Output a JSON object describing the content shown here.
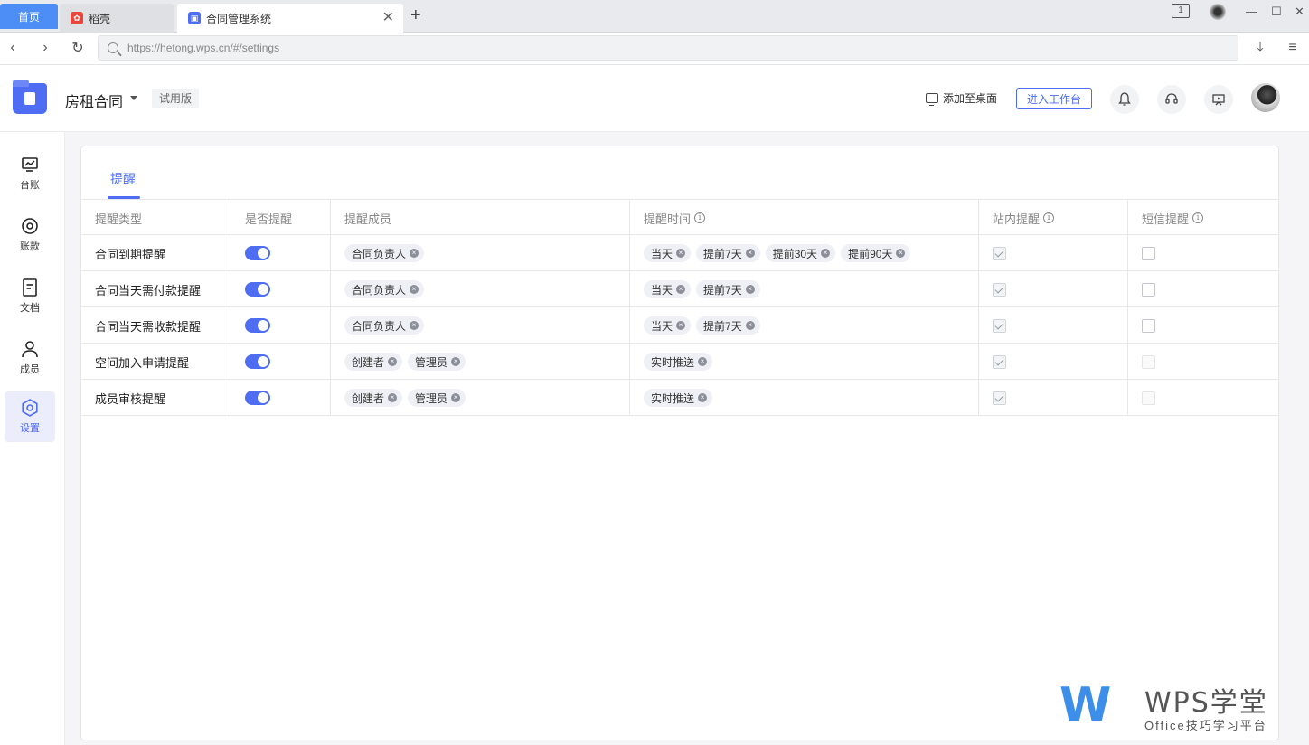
{
  "browser": {
    "home_tab": "首页",
    "tabs": [
      {
        "label": "稻壳",
        "favicon": "docer-icon"
      },
      {
        "label": "合同管理系统",
        "favicon": "contract-icon"
      }
    ],
    "new_tab": "+",
    "url": "https://hetong.wps.cn/#/settings"
  },
  "header": {
    "project_name": "房租合同",
    "trial_badge": "试用版",
    "add_desktop": "添加至桌面",
    "enter_workbench": "进入工作台"
  },
  "sidebar": {
    "items": [
      {
        "label": "台账",
        "icon": "ledger-icon"
      },
      {
        "label": "账款",
        "icon": "payment-icon"
      },
      {
        "label": "文档",
        "icon": "document-icon"
      },
      {
        "label": "成员",
        "icon": "member-icon"
      },
      {
        "label": "设置",
        "icon": "settings-icon",
        "active": true
      }
    ]
  },
  "panel": {
    "tab": "提醒",
    "columns": [
      "提醒类型",
      "是否提醒",
      "提醒成员",
      "提醒时间",
      "站内提醒",
      "短信提醒"
    ],
    "rows": [
      {
        "type": "合同到期提醒",
        "enabled": true,
        "members": [
          "合同负责人"
        ],
        "times": [
          "当天",
          "提前7天",
          "提前30天",
          "提前90天"
        ],
        "in_app": true,
        "sms": false,
        "sms_disabled": false
      },
      {
        "type": "合同当天需付款提醒",
        "enabled": true,
        "members": [
          "合同负责人"
        ],
        "times": [
          "当天",
          "提前7天"
        ],
        "in_app": true,
        "sms": false,
        "sms_disabled": false
      },
      {
        "type": "合同当天需收款提醒",
        "enabled": true,
        "members": [
          "合同负责人"
        ],
        "times": [
          "当天",
          "提前7天"
        ],
        "in_app": true,
        "sms": false,
        "sms_disabled": false
      },
      {
        "type": "空间加入申请提醒",
        "enabled": true,
        "members": [
          "创建者",
          "管理员"
        ],
        "times": [
          "实时推送"
        ],
        "in_app": true,
        "sms": false,
        "sms_disabled": true
      },
      {
        "type": "成员审核提醒",
        "enabled": true,
        "members": [
          "创建者",
          "管理员"
        ],
        "times": [
          "实时推送"
        ],
        "in_app": true,
        "sms": false,
        "sms_disabled": true
      }
    ]
  },
  "watermark": {
    "logo_letter": "W",
    "title": "WPS学堂",
    "subtitle": "Office技巧学习平台"
  },
  "colors": {
    "accent": "#4e6df2",
    "home_tab": "#4c8df6",
    "watermark_blue": "#3c8ee8"
  }
}
